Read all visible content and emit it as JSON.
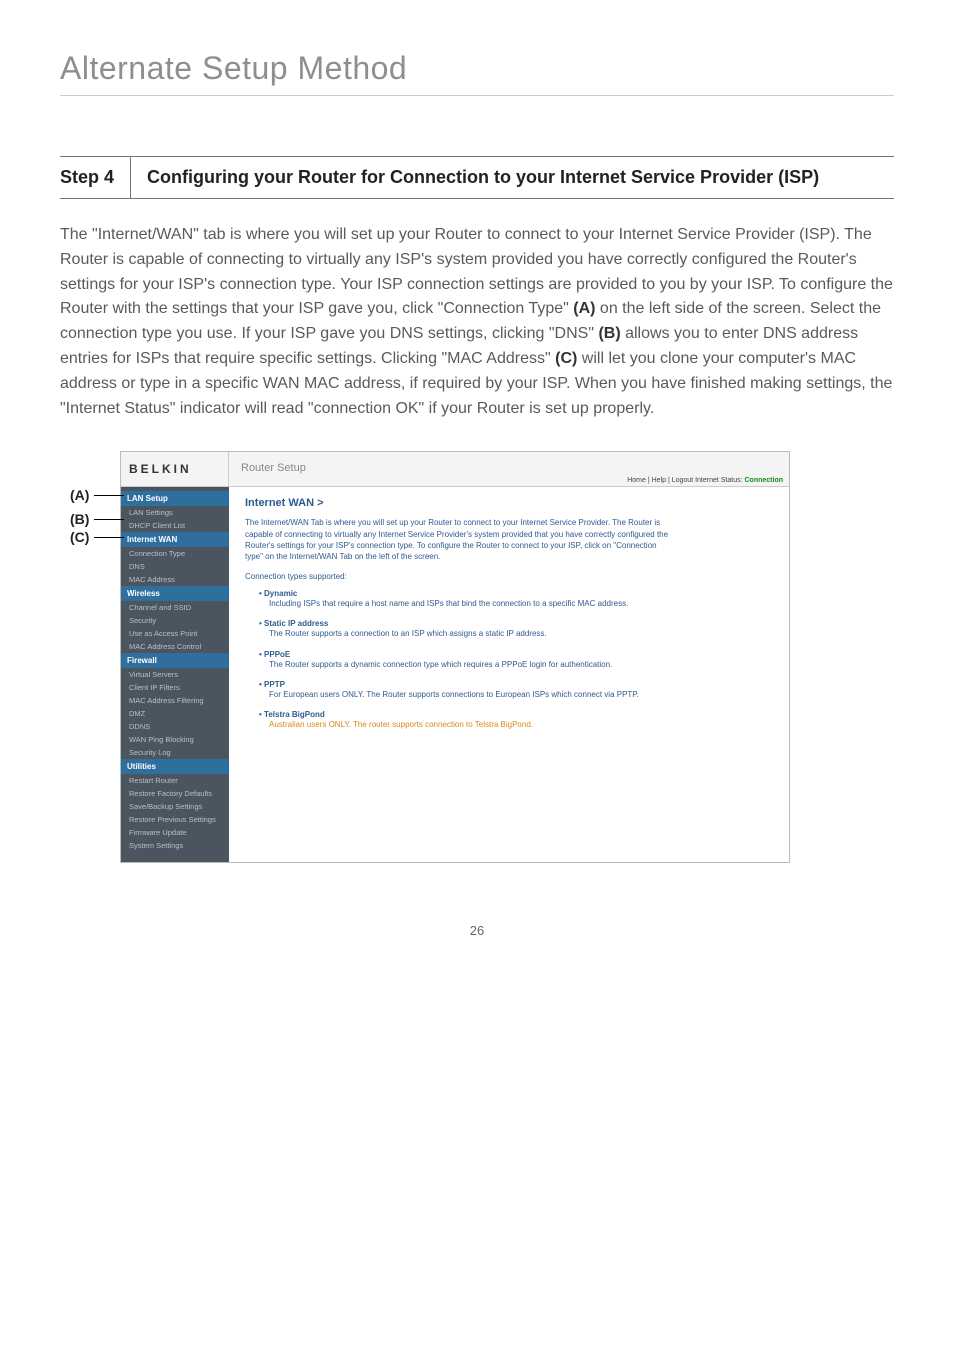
{
  "page": {
    "title": "Alternate Setup Method",
    "step_label": "Step 4",
    "step_heading": "Configuring your Router for Connection to your Internet Service Provider (ISP)",
    "body_pre": "The \"Internet/WAN\" tab is where you will set up your Router to connect to your Internet Service Provider (ISP). The Router is capable of connecting to virtually any ISP's system provided you have correctly configured the Router's settings for your ISP's connection type. Your ISP connection settings are provided to you by your ISP. To configure the Router with the settings that your ISP gave you, click \"Connection Type\" ",
    "ref_a": "(A)",
    "body_mid1": " on the left side of the screen. Select the connection type you use. If your ISP gave you DNS settings, clicking \"DNS\" ",
    "ref_b": "(B)",
    "body_mid2": " allows you to enter DNS address entries for ISPs that require specific settings. Clicking \"MAC Address\" ",
    "ref_c": "(C)",
    "body_post": " will let you clone your computer's MAC address or type in a specific WAN MAC address, if required by your ISP. When you have finished making settings, the \"Internet Status\" indicator will read \"connection OK\" if your Router is set up properly.",
    "page_number": "26"
  },
  "callouts": {
    "a": "(A)",
    "b": "(B)",
    "c": "(C)"
  },
  "router": {
    "logo": "BELKIN",
    "header_title": "Router Setup",
    "toplinks_left": "Home | Help | Logout   Internet Status: ",
    "toplinks_status": "Connection",
    "content_title": "Internet WAN >",
    "content_desc": "The Internet/WAN Tab is where you will set up your Router to connect to your Internet Service Provider. The Router is capable of connecting to virtually any Internet Service Provider's system provided that you have correctly configured the Router's settings for your ISP's connection type. To configure the Router to connect to your ISP, click on \"Connection type\" on the Internet/WAN Tab on the left of the screen.",
    "content_supported": "Connection types supported:",
    "sidebar": [
      {
        "type": "head",
        "label": "LAN Setup"
      },
      {
        "type": "item",
        "label": "LAN Settings"
      },
      {
        "type": "item",
        "label": "DHCP Client List"
      },
      {
        "type": "head",
        "label": "Internet WAN"
      },
      {
        "type": "item",
        "label": "Connection Type"
      },
      {
        "type": "item",
        "label": "DNS"
      },
      {
        "type": "item",
        "label": "MAC Address"
      },
      {
        "type": "head",
        "label": "Wireless"
      },
      {
        "type": "item",
        "label": "Channel and SSID"
      },
      {
        "type": "item",
        "label": "Security"
      },
      {
        "type": "item",
        "label": "Use as Access Point"
      },
      {
        "type": "item",
        "label": "MAC Address Control"
      },
      {
        "type": "head",
        "label": "Firewall"
      },
      {
        "type": "item",
        "label": "Virtual Servers"
      },
      {
        "type": "item",
        "label": "Client IP Filters"
      },
      {
        "type": "item",
        "label": "MAC Address Filtering"
      },
      {
        "type": "item",
        "label": "DMZ"
      },
      {
        "type": "item",
        "label": "DDNS"
      },
      {
        "type": "item",
        "label": "WAN Ping Blocking"
      },
      {
        "type": "item",
        "label": "Security Log"
      },
      {
        "type": "head",
        "label": "Utilities"
      },
      {
        "type": "item",
        "label": "Restart Router"
      },
      {
        "type": "item",
        "label": "Restore Factory Defaults"
      },
      {
        "type": "item",
        "label": "Save/Backup Settings"
      },
      {
        "type": "item",
        "label": "Restore Previous Settings"
      },
      {
        "type": "item",
        "label": "Firmware Update"
      },
      {
        "type": "item",
        "label": "System Settings"
      }
    ],
    "ctypes": [
      {
        "title": "Dynamic",
        "desc": "Including ISPs that require a host name and ISPs that bind the connection to a specific MAC address.",
        "orange": false
      },
      {
        "title": "Static IP address",
        "desc": "The Router supports a connection to an ISP which assigns a static IP address.",
        "orange": false
      },
      {
        "title": "PPPoE",
        "desc": "The Router supports a dynamic connection type which requires a PPPoE login for authentication.",
        "orange": false
      },
      {
        "title": "PPTP",
        "desc": "For European users ONLY. The Router supports connections to European ISPs which connect via PPTP.",
        "orange": false
      },
      {
        "title": "Telstra BigPond",
        "desc": "Australian users ONLY. The router supports connection to Telstra BigPond.",
        "orange": true
      }
    ]
  }
}
